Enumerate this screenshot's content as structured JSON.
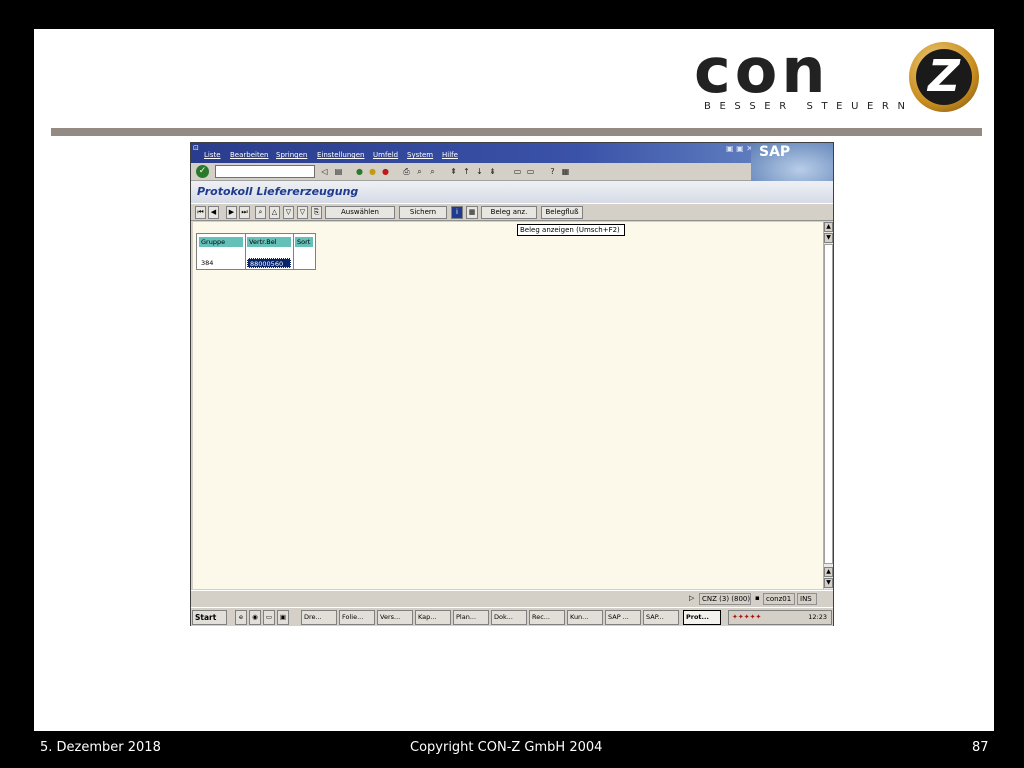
{
  "logo": {
    "text": "con",
    "circle_letter": "Z",
    "tagline": "BESSER STEUERN"
  },
  "sap_window": {
    "menu": [
      "Liste",
      "Bearbeiten",
      "Springen",
      "Einstellungen",
      "Umfeld",
      "System",
      "Hilfe"
    ],
    "sap_logo": "SAP",
    "title": "Protokoll Liefererzeugung",
    "app_buttons": {
      "auswaehlen": "Auswählen",
      "sichern": "Sichern",
      "beleg_anz": "Beleg anz.",
      "belegfluss": "Belegfluß"
    },
    "tooltip": "Beleg anzeigen   (Umsch+F2)",
    "grid": {
      "headers": [
        "Gruppe",
        "Vertr.Bel",
        "Sort"
      ],
      "rows": [
        {
          "gruppe": "384",
          "vertr_bel": "88000560",
          "sort": ""
        }
      ]
    },
    "status": {
      "system": "CNZ (3) (800)",
      "server": "conz01",
      "mode": "INS"
    },
    "taskbar": {
      "start": "Start",
      "items": [
        "Dre...",
        "Folie...",
        "Vers...",
        "Kap...",
        "Plan...",
        "Dok...",
        "Rec...",
        "Kun...",
        "SAP ...",
        "SAP...",
        "Prot..."
      ],
      "clock": "12:23"
    }
  },
  "footer": {
    "date": "5. Dezember 2018",
    "copyright": "Copyright CON-Z GmbH 2004",
    "page": "87"
  }
}
